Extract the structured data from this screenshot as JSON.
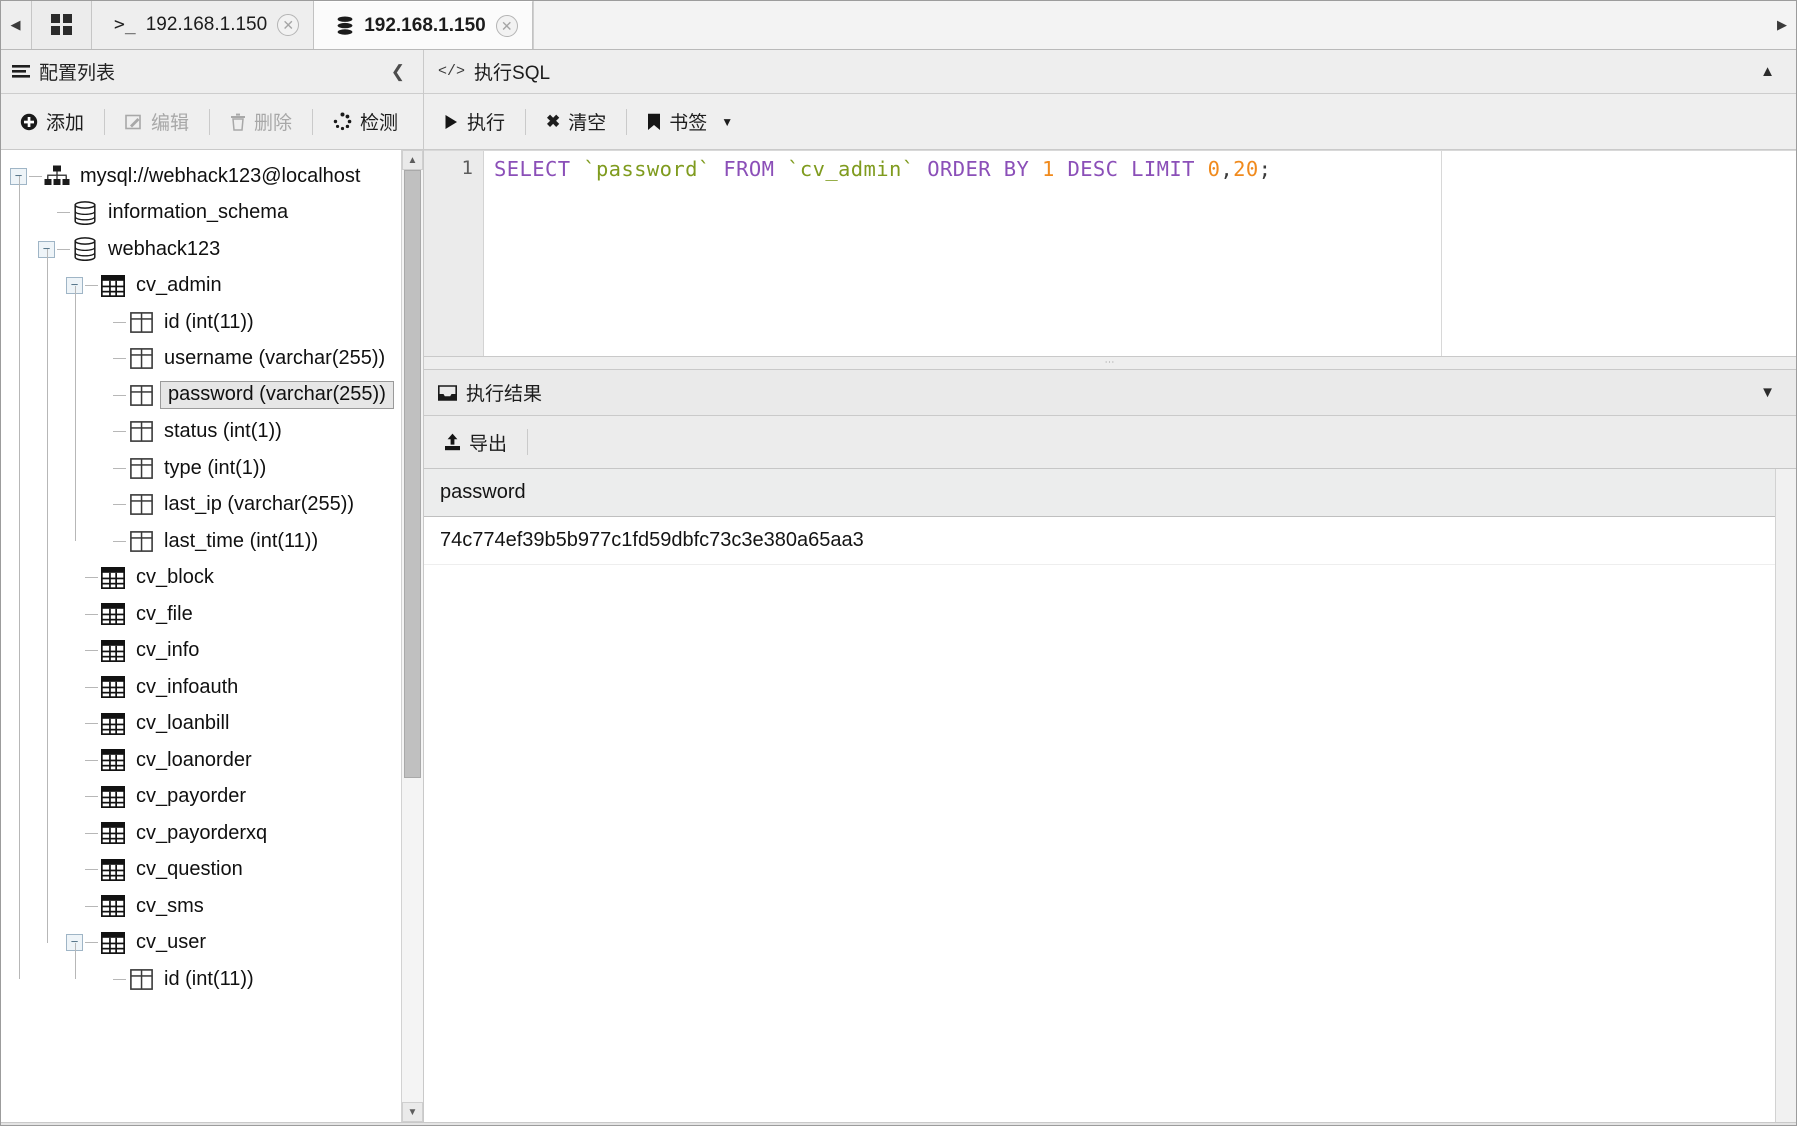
{
  "tabbar": {
    "left_arrow_icon": "chevron-left-icon",
    "right_arrow_icon": "chevron-right-icon",
    "grid_button_icon": "grid-apps-icon",
    "tabs": [
      {
        "label": "192.168.1.150",
        "icon": "terminal-prompt-icon",
        "icon_glyph": ">_",
        "active": false,
        "close_glyph": "✕"
      },
      {
        "label": "192.168.1.150",
        "icon": "database-stack-icon",
        "icon_glyph": "≣",
        "active": true,
        "close_glyph": "✕"
      }
    ]
  },
  "left_panel": {
    "title": "配置列表",
    "title_icon": "list-lines-icon",
    "collapse_icon": "chevron-left-icon",
    "toolbar": [
      {
        "label": "添加",
        "icon": "plus-circle-icon",
        "glyph": "⊕",
        "disabled": false
      },
      {
        "label": "编辑",
        "icon": "pencil-square-icon",
        "glyph": "✎",
        "disabled": true
      },
      {
        "label": "删除",
        "icon": "trash-icon",
        "glyph": "Ὕ1",
        "disabled": true
      },
      {
        "label": "检测",
        "icon": "spinner-dots-icon",
        "glyph": "◌",
        "disabled": false
      }
    ],
    "tree": [
      {
        "label": "mysql://webhack123@localhost",
        "icon": "server-connection-icon",
        "depth": 0,
        "twist": "−",
        "selected": false
      },
      {
        "label": "information_schema",
        "icon": "database-icon",
        "depth": 1,
        "twist": "",
        "selected": false
      },
      {
        "label": "webhack123",
        "icon": "database-icon",
        "depth": 1,
        "twist": "−",
        "selected": false
      },
      {
        "label": "cv_admin",
        "icon": "table-icon",
        "depth": 2,
        "twist": "−",
        "selected": false
      },
      {
        "label": "id (int(11))",
        "icon": "column-icon",
        "depth": 3,
        "twist": "",
        "selected": false
      },
      {
        "label": "username (varchar(255))",
        "icon": "column-icon",
        "depth": 3,
        "twist": "",
        "selected": false
      },
      {
        "label": "password (varchar(255))",
        "icon": "column-icon",
        "depth": 3,
        "twist": "",
        "selected": true
      },
      {
        "label": "status (int(1))",
        "icon": "column-icon",
        "depth": 3,
        "twist": "",
        "selected": false
      },
      {
        "label": "type (int(1))",
        "icon": "column-icon",
        "depth": 3,
        "twist": "",
        "selected": false
      },
      {
        "label": "last_ip (varchar(255))",
        "icon": "column-icon",
        "depth": 3,
        "twist": "",
        "selected": false
      },
      {
        "label": "last_time (int(11))",
        "icon": "column-icon",
        "depth": 3,
        "twist": "",
        "selected": false
      },
      {
        "label": "cv_block",
        "icon": "table-icon",
        "depth": 2,
        "twist": "",
        "selected": false
      },
      {
        "label": "cv_file",
        "icon": "table-icon",
        "depth": 2,
        "twist": "",
        "selected": false
      },
      {
        "label": "cv_info",
        "icon": "table-icon",
        "depth": 2,
        "twist": "",
        "selected": false
      },
      {
        "label": "cv_infoauth",
        "icon": "table-icon",
        "depth": 2,
        "twist": "",
        "selected": false
      },
      {
        "label": "cv_loanbill",
        "icon": "table-icon",
        "depth": 2,
        "twist": "",
        "selected": false
      },
      {
        "label": "cv_loanorder",
        "icon": "table-icon",
        "depth": 2,
        "twist": "",
        "selected": false
      },
      {
        "label": "cv_payorder",
        "icon": "table-icon",
        "depth": 2,
        "twist": "",
        "selected": false
      },
      {
        "label": "cv_payorderxq",
        "icon": "table-icon",
        "depth": 2,
        "twist": "",
        "selected": false
      },
      {
        "label": "cv_question",
        "icon": "table-icon",
        "depth": 2,
        "twist": "",
        "selected": false
      },
      {
        "label": "cv_sms",
        "icon": "table-icon",
        "depth": 2,
        "twist": "",
        "selected": false
      },
      {
        "label": "cv_user",
        "icon": "table-icon",
        "depth": 2,
        "twist": "−",
        "selected": false
      },
      {
        "label": "id (int(11))",
        "icon": "column-icon",
        "depth": 3,
        "twist": "",
        "selected": false
      }
    ]
  },
  "sql_panel": {
    "title": "执行SQL",
    "title_icon": "code-tags-icon",
    "title_icon_glyph": "</>",
    "collapse_icon": "chevron-up-icon",
    "toolbar": [
      {
        "label": "执行",
        "icon": "play-icon",
        "glyph": "▶"
      },
      {
        "label": "清空",
        "icon": "clear-x-icon",
        "glyph": "✖"
      },
      {
        "label": "书签",
        "icon": "bookmark-icon",
        "glyph": "⚑",
        "has_dropdown": true,
        "dropdown_glyph": "▼"
      }
    ],
    "line_number": "1",
    "query": {
      "full_text": "SELECT `password` FROM `cv_admin` ORDER BY 1 DESC LIMIT 0,20;",
      "tokens": [
        {
          "t": "SELECT",
          "k": "kw"
        },
        {
          "t": " ",
          "k": "pn"
        },
        {
          "t": "`password`",
          "k": "idq"
        },
        {
          "t": " ",
          "k": "pn"
        },
        {
          "t": "FROM",
          "k": "kw"
        },
        {
          "t": " ",
          "k": "pn"
        },
        {
          "t": "`cv_admin`",
          "k": "idq"
        },
        {
          "t": " ",
          "k": "pn"
        },
        {
          "t": "ORDER BY",
          "k": "kw"
        },
        {
          "t": " ",
          "k": "pn"
        },
        {
          "t": "1",
          "k": "num"
        },
        {
          "t": " ",
          "k": "pn"
        },
        {
          "t": "DESC LIMIT",
          "k": "kw"
        },
        {
          "t": " ",
          "k": "pn"
        },
        {
          "t": "0",
          "k": "num"
        },
        {
          "t": ",",
          "k": "pn"
        },
        {
          "t": "20",
          "k": "num"
        },
        {
          "t": ";",
          "k": "pn"
        }
      ]
    },
    "colors": {
      "keyword": "#8b4fb8",
      "identifier": "#7f9b1e",
      "number": "#f08a1d",
      "punctuation": "#3b3b3b"
    }
  },
  "result_panel": {
    "title": "执行结果",
    "title_icon": "inbox-tray-icon",
    "collapse_icon": "chevron-down-icon",
    "toolbar": [
      {
        "label": "导出",
        "icon": "export-upload-icon",
        "glyph": "⬆"
      }
    ],
    "columns": [
      "password"
    ],
    "rows": [
      [
        "74c774ef39b5b977c1fd59dbfc73c3e380a65aa3"
      ]
    ]
  }
}
